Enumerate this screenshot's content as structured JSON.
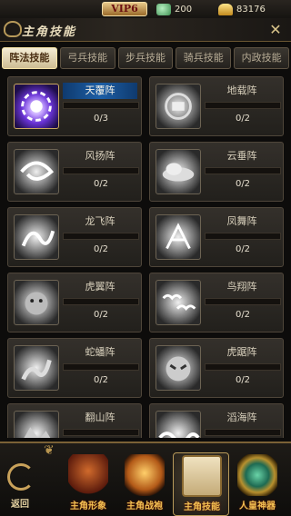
{
  "topbar": {
    "vip_label": "VIP6",
    "jade_amount": "200",
    "gold_amount": "83176"
  },
  "title": "主角技能",
  "tabs": [
    {
      "label": "阵法技能",
      "active": true
    },
    {
      "label": "弓兵技能",
      "active": false
    },
    {
      "label": "步兵技能",
      "active": false
    },
    {
      "label": "骑兵技能",
      "active": false
    },
    {
      "label": "内政技能",
      "active": false
    }
  ],
  "skills": [
    {
      "name": "天覆阵",
      "count": "0/3",
      "selected": true,
      "icon": "purple-vortex-icon"
    },
    {
      "name": "地载阵",
      "count": "0/2",
      "selected": false,
      "icon": "grey-emblem-icon"
    },
    {
      "name": "风扬阵",
      "count": "0/2",
      "selected": false,
      "icon": "whirlwind-icon"
    },
    {
      "name": "云垂阵",
      "count": "0/2",
      "selected": false,
      "icon": "cloud-icon"
    },
    {
      "name": "龙飞阵",
      "count": "0/2",
      "selected": false,
      "icon": "dragon-icon"
    },
    {
      "name": "凤舞阵",
      "count": "0/2",
      "selected": false,
      "icon": "phoenix-icon"
    },
    {
      "name": "虎翼阵",
      "count": "0/2",
      "selected": false,
      "icon": "tiger-icon"
    },
    {
      "name": "鸟翔阵",
      "count": "0/2",
      "selected": false,
      "icon": "birds-icon"
    },
    {
      "name": "蛇蟠阵",
      "count": "0/2",
      "selected": false,
      "icon": "snake-icon"
    },
    {
      "name": "虎踞阵",
      "count": "0/2",
      "selected": false,
      "icon": "beast-icon"
    },
    {
      "name": "翻山阵",
      "count": "",
      "selected": false,
      "icon": "mountain-icon"
    },
    {
      "name": "滔海阵",
      "count": "",
      "selected": false,
      "icon": "wave-icon"
    }
  ],
  "bottom_nav": {
    "back_label": "返回",
    "items": [
      {
        "label": "主角形象",
        "active": false
      },
      {
        "label": "主角战袍",
        "active": false
      },
      {
        "label": "主角技能",
        "active": true
      },
      {
        "label": "人皇神器",
        "active": false
      }
    ]
  }
}
